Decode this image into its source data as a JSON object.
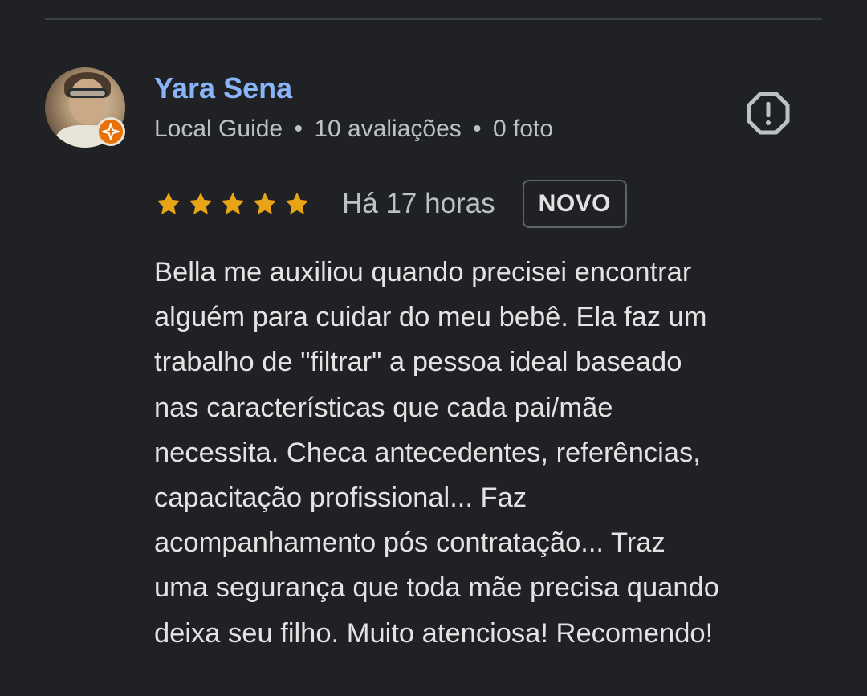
{
  "reviewer": {
    "name": "Yara Sena",
    "role": "Local Guide",
    "reviews_count": "10 avaliações",
    "photos_count": "0 foto",
    "separator": "•"
  },
  "review": {
    "rating": 5,
    "time": "Há 17 horas",
    "badge": "NOVO",
    "text_lines": [
      "Bella me auxiliou quando precisei encontrar",
      "alguém para cuidar do meu bebê. Ela faz um",
      "trabalho de \"filtrar\" a pessoa ideal baseado",
      "nas características que cada pai/mãe",
      "necessita. Checa antecedentes, referências,",
      "capacitação profissional... Faz",
      "acompanhamento pós contratação... Traz",
      "uma segurança que toda mãe precisa quando",
      "deixa seu filho. Muito atenciosa! Recomendo!"
    ]
  },
  "icons": {
    "report": "report-flag-icon",
    "star": "star-icon",
    "local_guide": "local-guide-badge-icon"
  },
  "colors": {
    "background": "#202124",
    "name": "#8ab4f8",
    "star": "#e8a317",
    "guide_badge": "#e8710a"
  }
}
